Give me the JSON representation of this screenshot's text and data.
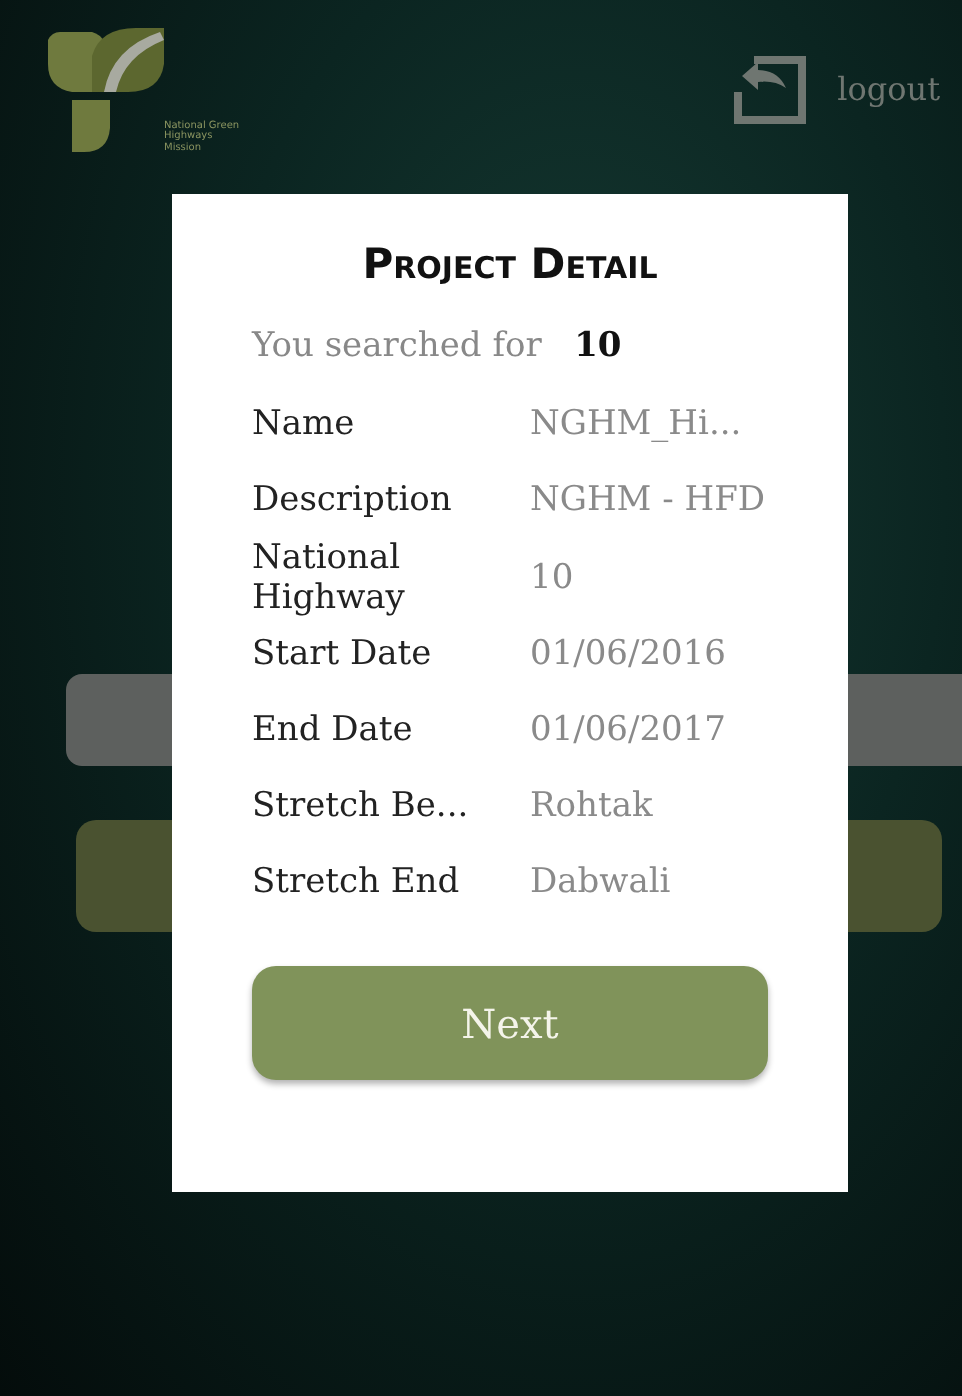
{
  "header": {
    "logo_text": "National Green Highways Mission",
    "logout": "logout"
  },
  "dialog": {
    "title": "Project Detail",
    "search_label": "You searched for",
    "search_value": "10",
    "rows": [
      {
        "label": "Name",
        "value": "NGHM_Hi..."
      },
      {
        "label": "Description",
        "value": "NGHM - HFD"
      },
      {
        "label": "National Highway",
        "value": "10"
      },
      {
        "label": "Start Date",
        "value": "01/06/2016"
      },
      {
        "label": "End Date",
        "value": "01/06/2017"
      },
      {
        "label": "Stretch Be...",
        "value": "Rohtak"
      },
      {
        "label": "Stretch End",
        "value": "Dabwali"
      }
    ],
    "button": "Next"
  }
}
